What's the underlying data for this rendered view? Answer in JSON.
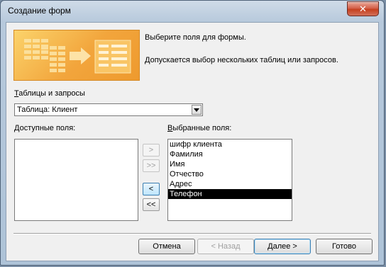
{
  "window": {
    "title": "Создание форм",
    "close_glyph": "✕"
  },
  "intro": {
    "line1": "Выберите поля для формы.",
    "line2": "Допускается выбор нескольких таблиц или запросов."
  },
  "tables_label": {
    "access_key": "Т",
    "rest": "аблицы и запросы"
  },
  "table_combo": {
    "value": "Таблица: Клиент",
    "arrow_icon": "dropdown-arrow"
  },
  "available_label": {
    "access_key": "Д",
    "rest": "оступные поля:"
  },
  "available_fields": [],
  "selected_label": {
    "access_key": "В",
    "rest": "ыбранные поля:"
  },
  "selected_fields": [
    "шифр клиента",
    "Фамилия",
    "Имя",
    "Отчество",
    "Адрес",
    "Телефон"
  ],
  "selected_index": 5,
  "move_buttons": {
    "add_one": ">",
    "add_all": ">>",
    "remove_one": "<",
    "remove_all": "<<"
  },
  "footer": {
    "cancel": "Отмена",
    "back": "< Назад",
    "next": "Далее >",
    "finish": "Готово"
  },
  "colors": {
    "banner": "#f2a53c",
    "selection": "#000000",
    "close_button": "#c5401f"
  }
}
